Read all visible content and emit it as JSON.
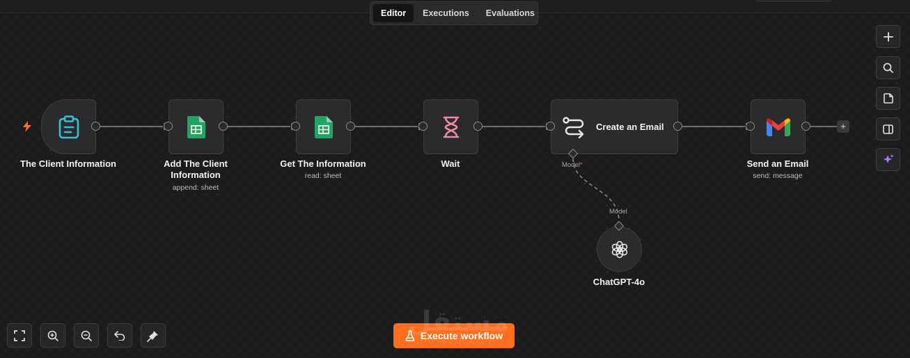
{
  "tabs": [
    {
      "label": "Editor",
      "active": true
    },
    {
      "label": "Executions",
      "active": false
    },
    {
      "label": "Evaluations",
      "active": false
    }
  ],
  "nodes": {
    "client_info": {
      "label": "The Client Information",
      "icon": "clipboard-icon",
      "trigger_icon": "lightning-icon"
    },
    "add_client": {
      "label_line1": "Add The Client",
      "label_line2": "Information",
      "subtitle": "append: sheet",
      "icon": "google-sheets-icon"
    },
    "get_info": {
      "label": "Get The Information",
      "subtitle": "read: sheet",
      "icon": "google-sheets-icon"
    },
    "wait": {
      "label": "Wait",
      "icon": "hourglass-icon"
    },
    "create_email": {
      "label": "Create an Email",
      "model_port": "Model",
      "required_mark": "*",
      "icon": "route-icon"
    },
    "send_email": {
      "label": "Send an Email",
      "subtitle": "send: message",
      "icon": "gmail-icon"
    },
    "chatgpt": {
      "label": "ChatGPT-4o",
      "port": "Model",
      "icon": "openai-icon"
    }
  },
  "add_node_symbol": "+",
  "right_toolbar": [
    "plus-icon",
    "search-icon",
    "sticky-note-icon",
    "panel-icon",
    "sparkle-icon"
  ],
  "bottom_toolbar": [
    "fit-view-icon",
    "zoom-in-icon",
    "zoom-out-icon",
    "undo-icon",
    "clean-up-icon"
  ],
  "execute_button": {
    "label": "Execute workflow",
    "icon": "flask-icon"
  },
  "watermark": {
    "arabic": "مستقل",
    "latin": "mostaqi.com"
  },
  "colors": {
    "accent": "#ff6d1f",
    "clipboard": "#35c2d8",
    "sheets": "#21a464",
    "hourglass": "#f08aa0",
    "sparkle": "#b07cff",
    "required": "#ff5a5a"
  }
}
